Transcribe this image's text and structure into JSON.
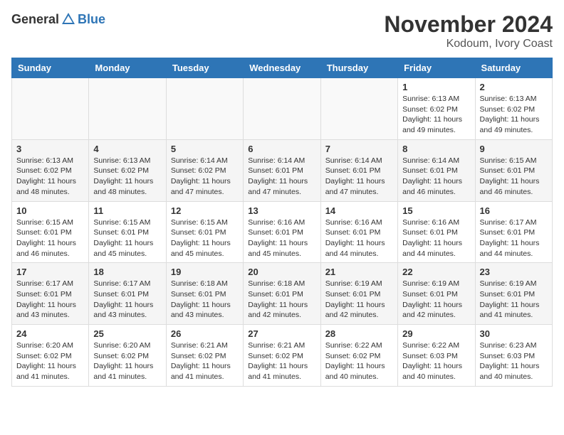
{
  "logo": {
    "general": "General",
    "blue": "Blue"
  },
  "title": "November 2024",
  "subtitle": "Kodoum, Ivory Coast",
  "weekdays": [
    "Sunday",
    "Monday",
    "Tuesday",
    "Wednesday",
    "Thursday",
    "Friday",
    "Saturday"
  ],
  "weeks": [
    [
      {
        "day": "",
        "info": ""
      },
      {
        "day": "",
        "info": ""
      },
      {
        "day": "",
        "info": ""
      },
      {
        "day": "",
        "info": ""
      },
      {
        "day": "",
        "info": ""
      },
      {
        "day": "1",
        "info": "Sunrise: 6:13 AM\nSunset: 6:02 PM\nDaylight: 11 hours and 49 minutes."
      },
      {
        "day": "2",
        "info": "Sunrise: 6:13 AM\nSunset: 6:02 PM\nDaylight: 11 hours and 49 minutes."
      }
    ],
    [
      {
        "day": "3",
        "info": "Sunrise: 6:13 AM\nSunset: 6:02 PM\nDaylight: 11 hours and 48 minutes."
      },
      {
        "day": "4",
        "info": "Sunrise: 6:13 AM\nSunset: 6:02 PM\nDaylight: 11 hours and 48 minutes."
      },
      {
        "day": "5",
        "info": "Sunrise: 6:14 AM\nSunset: 6:02 PM\nDaylight: 11 hours and 47 minutes."
      },
      {
        "day": "6",
        "info": "Sunrise: 6:14 AM\nSunset: 6:01 PM\nDaylight: 11 hours and 47 minutes."
      },
      {
        "day": "7",
        "info": "Sunrise: 6:14 AM\nSunset: 6:01 PM\nDaylight: 11 hours and 47 minutes."
      },
      {
        "day": "8",
        "info": "Sunrise: 6:14 AM\nSunset: 6:01 PM\nDaylight: 11 hours and 46 minutes."
      },
      {
        "day": "9",
        "info": "Sunrise: 6:15 AM\nSunset: 6:01 PM\nDaylight: 11 hours and 46 minutes."
      }
    ],
    [
      {
        "day": "10",
        "info": "Sunrise: 6:15 AM\nSunset: 6:01 PM\nDaylight: 11 hours and 46 minutes."
      },
      {
        "day": "11",
        "info": "Sunrise: 6:15 AM\nSunset: 6:01 PM\nDaylight: 11 hours and 45 minutes."
      },
      {
        "day": "12",
        "info": "Sunrise: 6:15 AM\nSunset: 6:01 PM\nDaylight: 11 hours and 45 minutes."
      },
      {
        "day": "13",
        "info": "Sunrise: 6:16 AM\nSunset: 6:01 PM\nDaylight: 11 hours and 45 minutes."
      },
      {
        "day": "14",
        "info": "Sunrise: 6:16 AM\nSunset: 6:01 PM\nDaylight: 11 hours and 44 minutes."
      },
      {
        "day": "15",
        "info": "Sunrise: 6:16 AM\nSunset: 6:01 PM\nDaylight: 11 hours and 44 minutes."
      },
      {
        "day": "16",
        "info": "Sunrise: 6:17 AM\nSunset: 6:01 PM\nDaylight: 11 hours and 44 minutes."
      }
    ],
    [
      {
        "day": "17",
        "info": "Sunrise: 6:17 AM\nSunset: 6:01 PM\nDaylight: 11 hours and 43 minutes."
      },
      {
        "day": "18",
        "info": "Sunrise: 6:17 AM\nSunset: 6:01 PM\nDaylight: 11 hours and 43 minutes."
      },
      {
        "day": "19",
        "info": "Sunrise: 6:18 AM\nSunset: 6:01 PM\nDaylight: 11 hours and 43 minutes."
      },
      {
        "day": "20",
        "info": "Sunrise: 6:18 AM\nSunset: 6:01 PM\nDaylight: 11 hours and 42 minutes."
      },
      {
        "day": "21",
        "info": "Sunrise: 6:19 AM\nSunset: 6:01 PM\nDaylight: 11 hours and 42 minutes."
      },
      {
        "day": "22",
        "info": "Sunrise: 6:19 AM\nSunset: 6:01 PM\nDaylight: 11 hours and 42 minutes."
      },
      {
        "day": "23",
        "info": "Sunrise: 6:19 AM\nSunset: 6:01 PM\nDaylight: 11 hours and 41 minutes."
      }
    ],
    [
      {
        "day": "24",
        "info": "Sunrise: 6:20 AM\nSunset: 6:02 PM\nDaylight: 11 hours and 41 minutes."
      },
      {
        "day": "25",
        "info": "Sunrise: 6:20 AM\nSunset: 6:02 PM\nDaylight: 11 hours and 41 minutes."
      },
      {
        "day": "26",
        "info": "Sunrise: 6:21 AM\nSunset: 6:02 PM\nDaylight: 11 hours and 41 minutes."
      },
      {
        "day": "27",
        "info": "Sunrise: 6:21 AM\nSunset: 6:02 PM\nDaylight: 11 hours and 41 minutes."
      },
      {
        "day": "28",
        "info": "Sunrise: 6:22 AM\nSunset: 6:02 PM\nDaylight: 11 hours and 40 minutes."
      },
      {
        "day": "29",
        "info": "Sunrise: 6:22 AM\nSunset: 6:03 PM\nDaylight: 11 hours and 40 minutes."
      },
      {
        "day": "30",
        "info": "Sunrise: 6:23 AM\nSunset: 6:03 PM\nDaylight: 11 hours and 40 minutes."
      }
    ]
  ]
}
